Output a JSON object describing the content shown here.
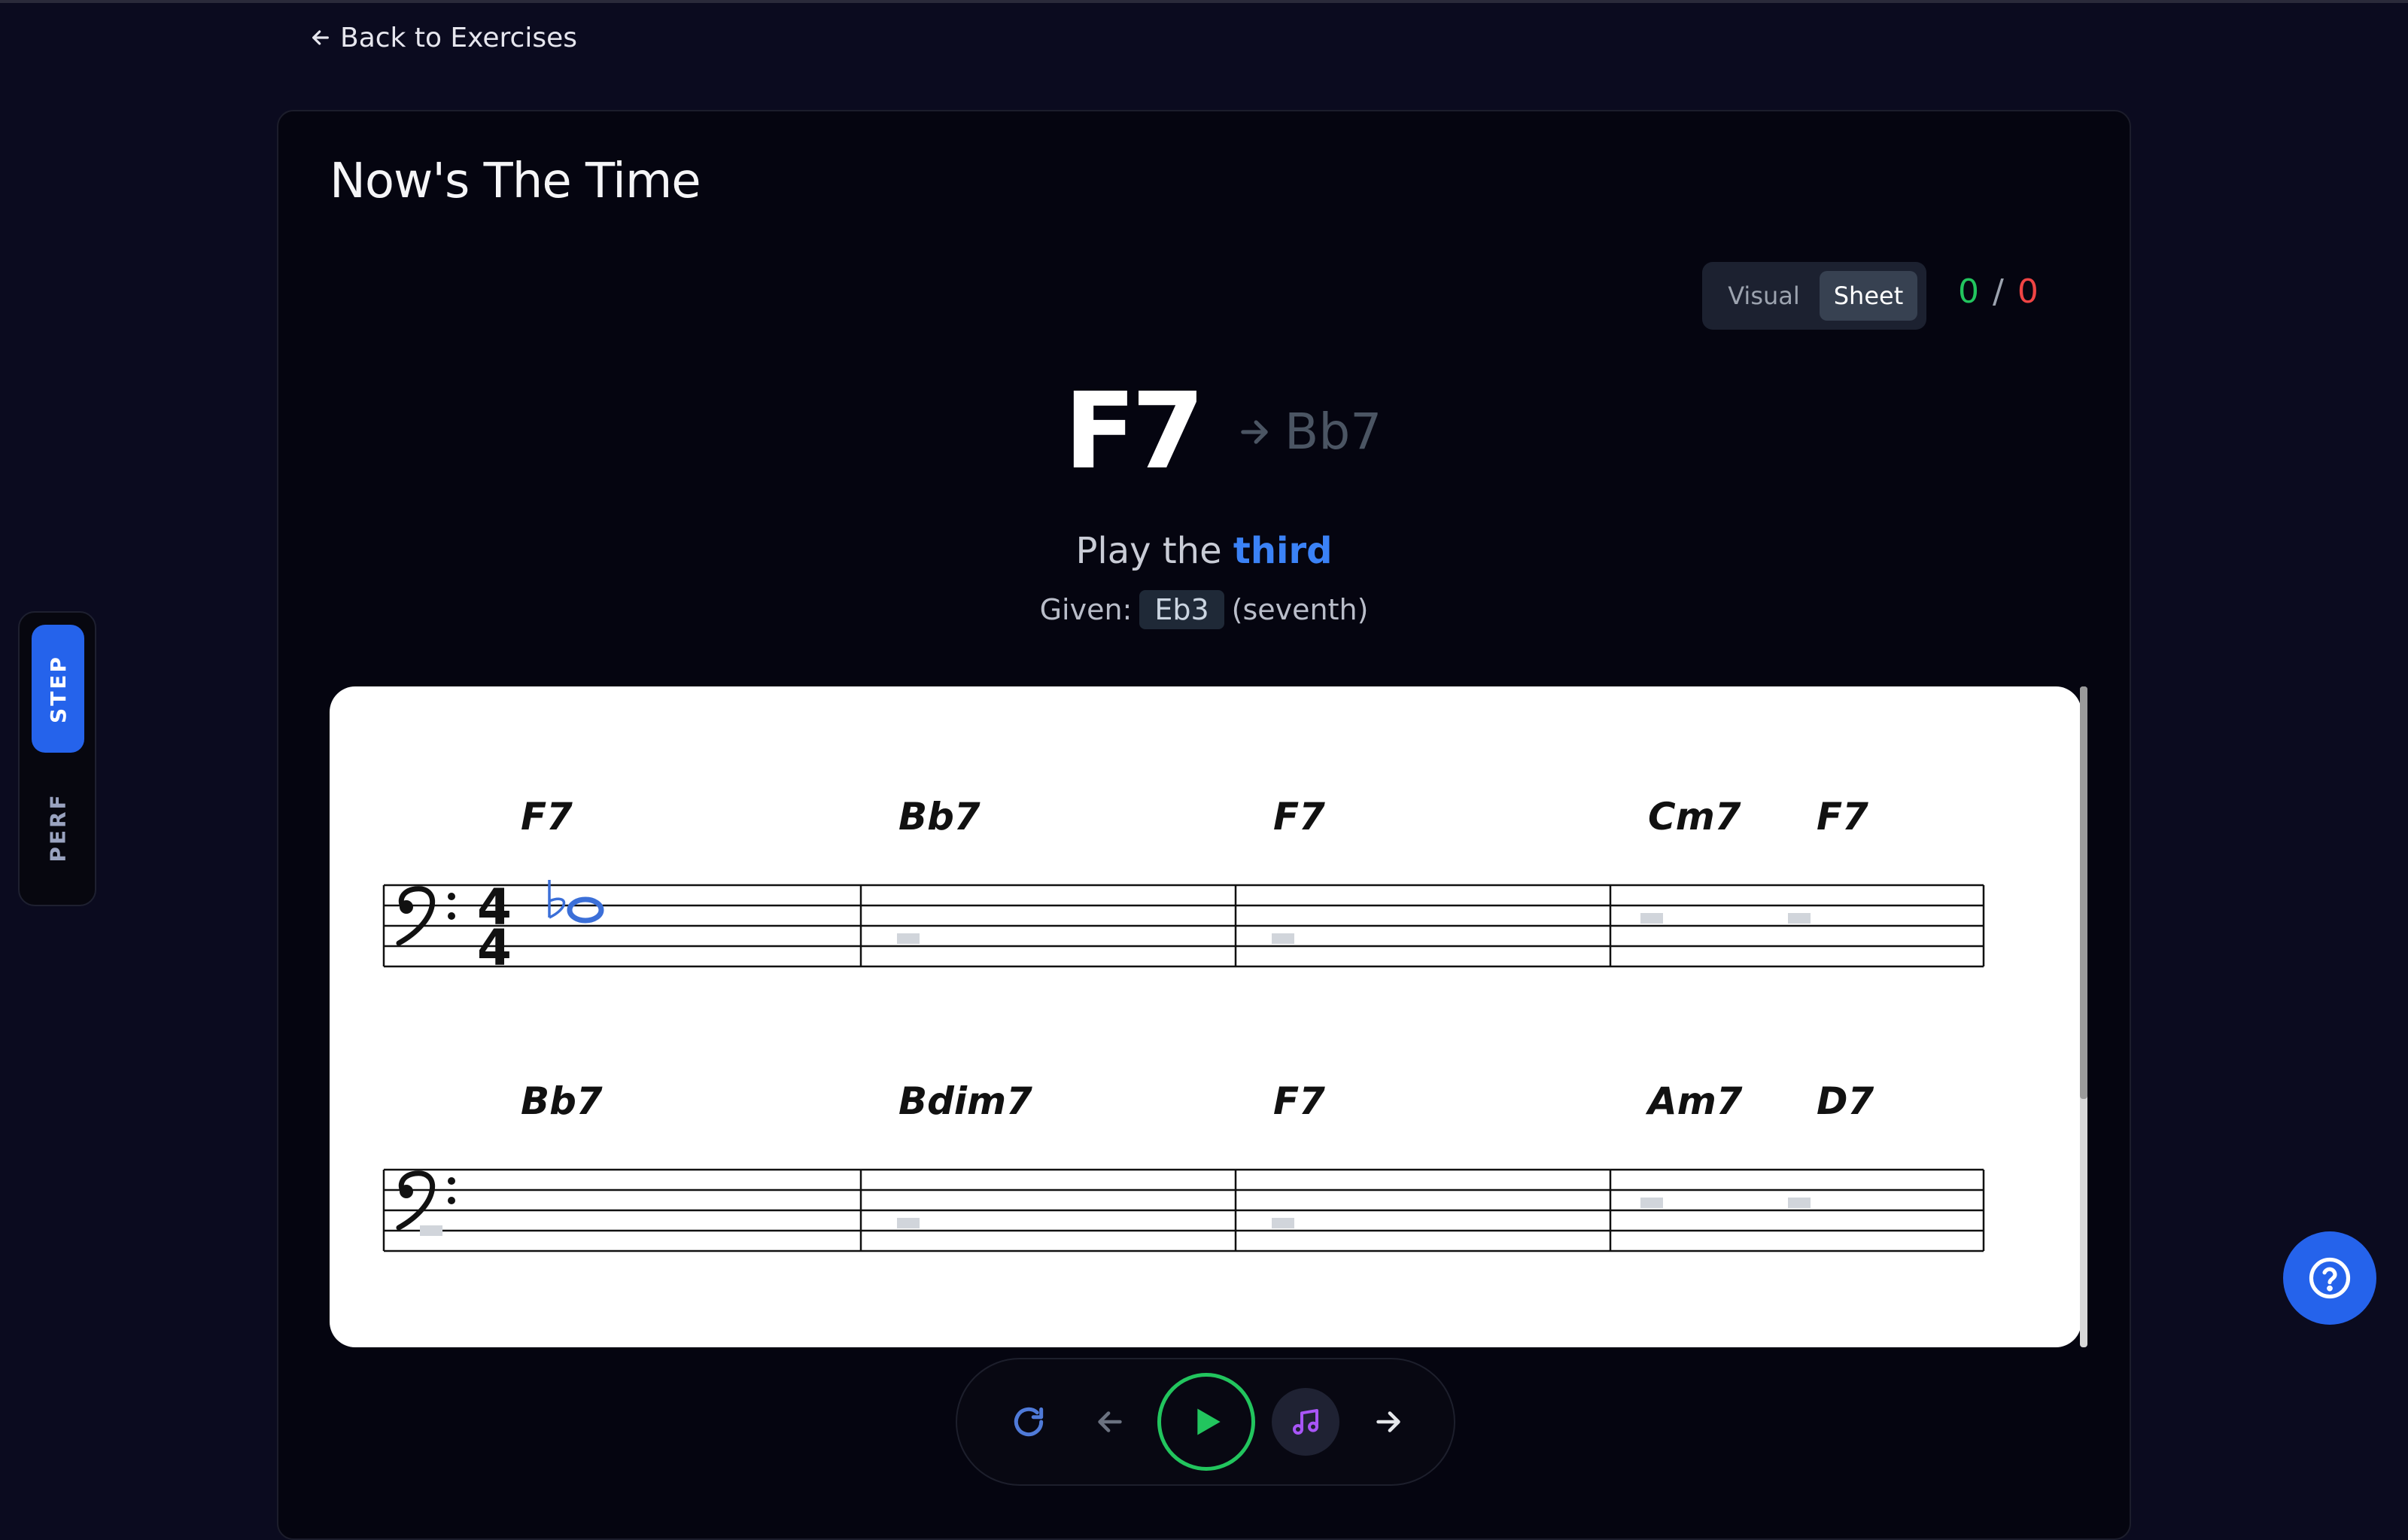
{
  "nav": {
    "back_label": "Back to Exercises"
  },
  "mode_toggle": {
    "step_label": "STEP",
    "perf_label": "PERF",
    "active": "STEP"
  },
  "exercise": {
    "title": "Now's The Time"
  },
  "view_toggle": {
    "visual_label": "Visual",
    "sheet_label": "Sheet",
    "active": "Sheet"
  },
  "score": {
    "correct": "0",
    "separator": "/",
    "wrong": "0"
  },
  "chord": {
    "current": "F7",
    "next": "Bb7"
  },
  "prompt": {
    "prefix": "Play the",
    "target": "third",
    "given_label": "Given:",
    "given_note": "Eb3",
    "given_role": "(seventh)"
  },
  "sheet": {
    "time_signature": {
      "top": "4",
      "bottom": "4"
    },
    "systems": [
      {
        "measures": [
          {
            "chords": [
              "F7"
            ],
            "note": "Eb3"
          },
          {
            "chords": [
              "Bb7"
            ]
          },
          {
            "chords": [
              "F7"
            ]
          },
          {
            "chords": [
              "Cm7",
              "F7"
            ]
          }
        ]
      },
      {
        "measures": [
          {
            "chords": [
              "Bb7"
            ]
          },
          {
            "chords": [
              "Bdim7"
            ]
          },
          {
            "chords": [
              "F7"
            ]
          },
          {
            "chords": [
              "Am7",
              "D7"
            ]
          }
        ]
      }
    ]
  },
  "controls": {
    "restart_icon": "restart-icon",
    "prev_icon": "arrow-left-icon",
    "play_icon": "play-icon",
    "audio_icon": "music-note-icon",
    "next_icon": "arrow-right-icon"
  },
  "colors": {
    "accent": "#2563eb",
    "correct": "#22c55e",
    "wrong": "#ef4444",
    "given_note": "#3b6fd8",
    "play": "#22c55e",
    "audio": "#a855f7"
  }
}
